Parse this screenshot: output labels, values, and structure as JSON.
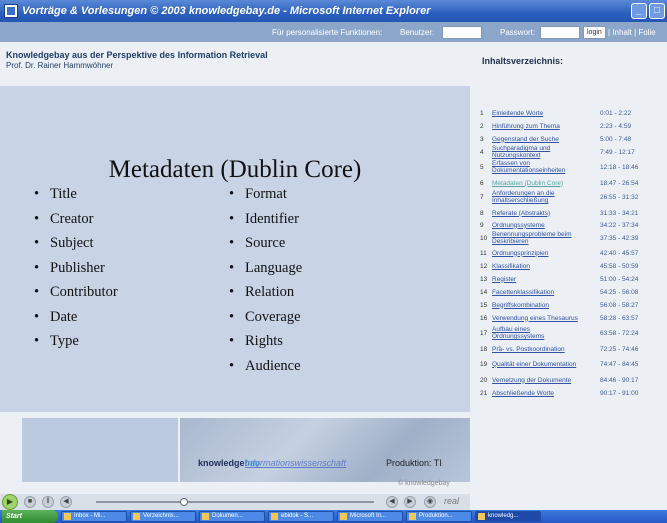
{
  "window": {
    "title": "Vorträge & Vorlesungen © 2003 knowledgebay.de - Microsoft Internet Explorer"
  },
  "loginbar": {
    "personal_label": "Für personalisierte Funktionen:",
    "user_label": "Benutzer:",
    "password_label": "Passwort:",
    "login_button": "login",
    "nav_links": "| Inhalt | Folie"
  },
  "header": {
    "title": "Knowledgebay aus der Perspektive des Information Retrieval",
    "author": "Prof. Dr. Rainer Hammwöhner"
  },
  "slide": {
    "title": "Metadaten (Dublin Core)",
    "left_items": [
      "Title",
      "Creator",
      "Subject",
      "Publisher",
      "Contributor",
      "Date",
      "Type"
    ],
    "right_items": [
      "Format",
      "Identifier",
      "Source",
      "Language",
      "Relation",
      "Coverage",
      "Rights",
      "Audience"
    ]
  },
  "footer": {
    "brand_knowledge": "knowledge",
    "brand_bay": "bay",
    "info_link": "Informationswissenschaft",
    "produktion": "Produktion: TI",
    "copyright": "© knowledgebay"
  },
  "player": {
    "play_icon": "play-icon",
    "real_label": "real"
  },
  "toc": {
    "heading": "Inhaltsverzeichnis:",
    "items": [
      {
        "num": "1",
        "label": "Einleitende Worte",
        "time": "0:01 - 2:22"
      },
      {
        "num": "2",
        "label": "Hinführung zum Thema",
        "time": "2:23 - 4:59"
      },
      {
        "num": "3",
        "label": "Gegenstand der Suche",
        "time": "5:00 - 7:48"
      },
      {
        "num": "4",
        "label": "Suchparadigma und Nutzungskontext",
        "time": "7:49 - 12:17"
      },
      {
        "num": "5",
        "label": "Erfassen von Dokumentationseinheiten",
        "time": "12:18 - 18:46"
      },
      {
        "num": "6",
        "label": "Metadaten (Dublin Core)",
        "time": "18:47 - 26:54"
      },
      {
        "num": "7",
        "label": "Anforderungen an die Inhaltserschließung",
        "time": "26:55 - 31:32"
      },
      {
        "num": "8",
        "label": "Referate (Abstrakts)",
        "time": "31:33 - 34:21"
      },
      {
        "num": "9",
        "label": "Ordnungssysteme",
        "time": "34:22 - 37:34"
      },
      {
        "num": "10",
        "label": "Benennungsprobleme beim Deskribieren",
        "time": "37:35 - 42:39"
      },
      {
        "num": "11",
        "label": "Ordnungsprinzipien",
        "time": "42:40 - 45:57"
      },
      {
        "num": "12",
        "label": "Klassifikation",
        "time": "45:58 - 50:59"
      },
      {
        "num": "13",
        "label": "Register",
        "time": "51:00 - 54:24"
      },
      {
        "num": "14",
        "label": "Facettenklassifikation",
        "time": "54:25 - 56:08"
      },
      {
        "num": "15",
        "label": "Begriffskombination",
        "time": "56:08 - 58:27"
      },
      {
        "num": "16",
        "label": "Verwendung eines Thesaurus",
        "time": "58:28 - 63:57"
      },
      {
        "num": "17",
        "label": "Aufbau eines Ordnungssystems",
        "time": "63:58 - 72:24"
      },
      {
        "num": "18",
        "label": "Prä- vs. Postkoordination",
        "time": "72:25 - 74:46"
      },
      {
        "num": "19",
        "label": "Qualität einer Dokumentation",
        "time": "74:47 - 84:45"
      },
      {
        "num": "20",
        "label": "Vernetzung der Dokumente",
        "time": "84:46 - 90:17"
      },
      {
        "num": "21",
        "label": "Abschließende Worte",
        "time": "90:17 - 91:00"
      }
    ]
  },
  "taskbar": {
    "start": "Start",
    "tasks": [
      "Inbox - Mi...",
      "Verzeichnis...",
      "Dokumen...",
      "ebidok - S...",
      "Microsoft In...",
      "Produktion...",
      "knowledg..."
    ]
  }
}
